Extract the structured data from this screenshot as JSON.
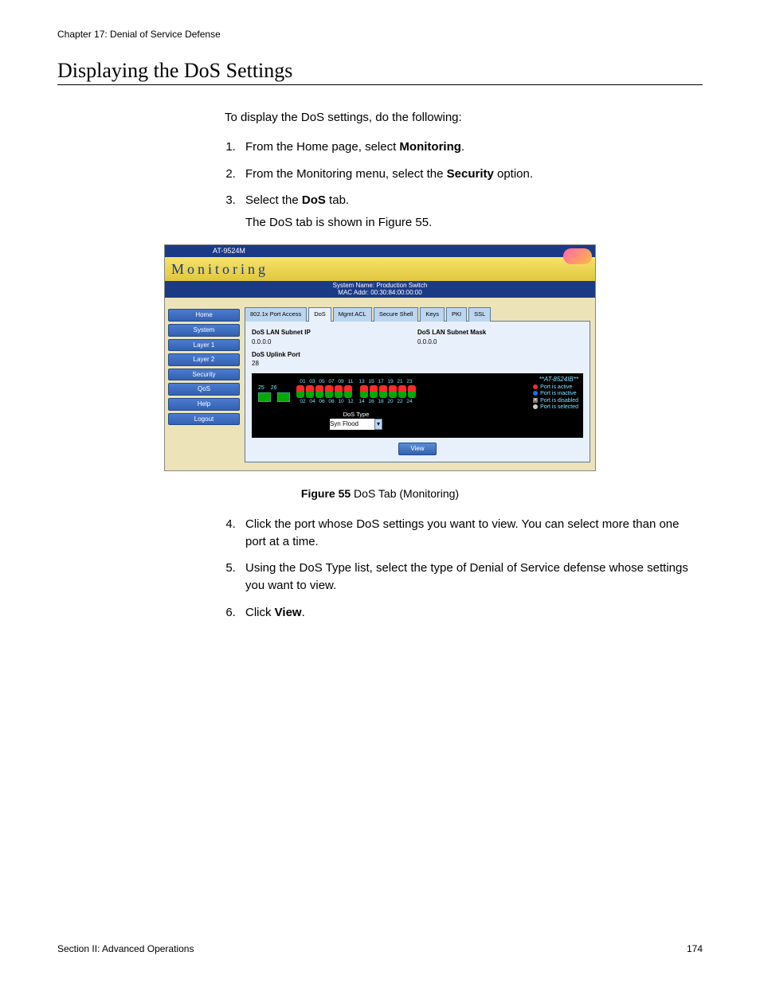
{
  "chapter_header": "Chapter 17: Denial of Service Defense",
  "section_title": "Displaying the DoS Settings",
  "intro": "To display the DoS settings, do the following:",
  "steps_part1": [
    {
      "pre": "From the Home page, select ",
      "bold": "Monitoring",
      "post": "."
    },
    {
      "pre": "From the Monitoring menu, select the ",
      "bold": "Security",
      "post": " option."
    },
    {
      "pre": "Select the ",
      "bold": "DoS",
      "post": " tab.",
      "sub": "The DoS tab is shown in Figure 55."
    }
  ],
  "figure_caption_prefix": "Figure 55",
  "figure_caption_text": "  DoS Tab (Monitoring)",
  "steps_part2": [
    {
      "pre": "Click the port whose DoS settings you want to view. You can select more than one port at a time.",
      "bold": "",
      "post": ""
    },
    {
      "pre": "Using the DoS Type list, select the type of Denial of Service defense whose settings you want to view.",
      "bold": "",
      "post": ""
    },
    {
      "pre": "Click ",
      "bold": "View",
      "post": "."
    }
  ],
  "footer_left": "Section II: Advanced Operations",
  "footer_right": "174",
  "app": {
    "menubar": "AT-9524M",
    "title": "Monitoring",
    "sys1": "System Name: Production Switch",
    "sys2": "MAC Addr: 00:30:84:00:00:00",
    "nav": [
      "Home",
      "System",
      "Layer 1",
      "Layer 2",
      "Security",
      "QoS",
      "Help",
      "Logout"
    ],
    "tabs": [
      "802.1x Port Access",
      "DoS",
      "Mgmt ACL",
      "Secure Shell",
      "Keys",
      "PKI",
      "SSL"
    ],
    "active_tab_index": 1,
    "panel": {
      "subnet_ip_label": "DoS LAN Subnet IP",
      "subnet_ip_value": "0.0.0.0",
      "subnet_mask_label": "DoS LAN Subnet Mask",
      "subnet_mask_value": "0.0.0.0",
      "uplink_label": "DoS Uplink Port",
      "uplink_value": "28"
    },
    "model_label": "**AT-8524IB**",
    "legend": {
      "active": "Port is active",
      "inactive": "Port is inactive",
      "disabled": "Port is disabled",
      "selected": "Port is selected"
    },
    "side_ports": [
      "25",
      "26"
    ],
    "top_port_nums": [
      "01",
      "03",
      "05",
      "07",
      "09",
      "11",
      "13",
      "15",
      "17",
      "19",
      "21",
      "23"
    ],
    "bottom_port_nums": [
      "02",
      "04",
      "06",
      "08",
      "10",
      "12",
      "14",
      "16",
      "18",
      "20",
      "22",
      "24"
    ],
    "dos_type_label": "DoS Type",
    "dos_type_value": "Syn Flood",
    "view_button": "View"
  }
}
